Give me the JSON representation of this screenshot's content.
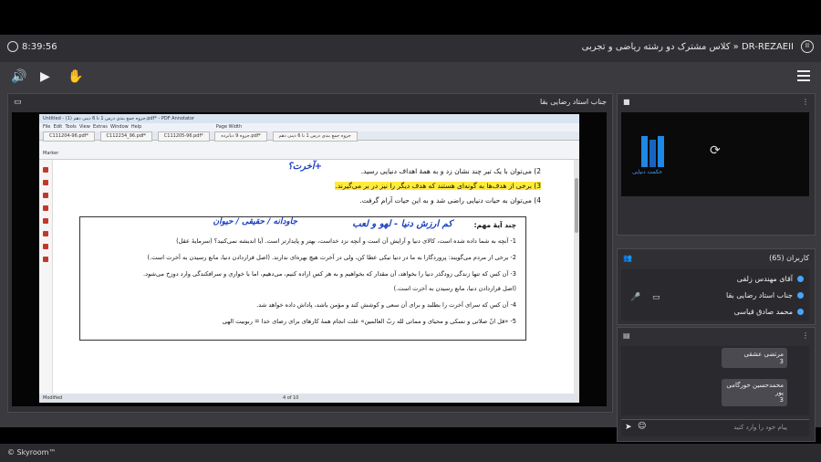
{
  "topbar": {
    "clock": "8:39:56",
    "room_title": "DR-REZAEII « کلاس مشترک دو رشته ریاضی و تجربی"
  },
  "toolbar": {
    "speaker_icon": "speaker-icon",
    "play_icon": "play-icon",
    "hand_icon": "raise-hand-icon"
  },
  "main_panel": {
    "title": "جناب استاد رضایی بقا",
    "pdf": {
      "window_title": "Untitled - جزوه جمع بندی درس 1 تا 6 دینی دهم (1).pdf* - PDF Annotator",
      "menu": [
        "File",
        "Edit",
        "Tools",
        "View",
        "Extras",
        "Window",
        "Help"
      ],
      "tabs": [
        "C111204-96.pdf*",
        "C112234_96.pdf*",
        "C111205-96.pdf*",
        "جزوه 9 دبانرده.pdf*",
        "جزوه جمع بندی درس 1 تا 6 دینی دهم"
      ],
      "zoom": "Page Width",
      "tool_label": "Marker",
      "lines": [
        "2) می‌توان با یک تیر چند نشان زد و به همهٔ اهداف دنیایی رسید.",
        "3) برخی از هدف‌ها به گونه‌ای هستند که هدف دیگر را نیز در بر می‌گیرند.",
        "4) می‌توان به حیات دنیایی راضی شد و به این حیات آرام گرفت."
      ],
      "handwriting": [
        "+آخرت؟",
        "کم ارزش دنیا - لهو و لعب",
        "جاودانه / حقیقی / حیوان"
      ],
      "box_title": "چند آیهٔ مهم:",
      "box_lines": [
        "1- آنچه به شما داده شده است، کالای دنیا و آرایش آن است و آنچه نزد خداست، بهتر و پایدارتر است. آیا اندیشه نمی‌کنید؟ (سرمایهٔ عقل)",
        "2- برخی از مردم می‌گویند: پروردگارا به ما در دنیا نیکی عطا کن، ولی در آخرت هیچ بهره‌ای ندارند. (اصل قراردادن دنیا، مانع رسیدن به آخرت است.)",
        "3- آن کس که تنها زندگی زودگذر دنیا را بخواهد، آن مقدار که بخواهیم و به هر کس اراده کنیم، می‌دهیم، اما با خواری و سرافکندگی وارد دوزخ می‌شود.",
        "(اصل قراردادن دنیا، مانع رسیدن به آخرت است.)",
        "4- آن کس که سرای آخرت را بطلبد و برای آن سعی و کوشش کند و مؤمن باشد، پاداش داده خواهد شد.",
        "5- «قل انّ صلاتی و نسکی و محیای و مماتی لله ربّ العالمین» علت انجام همهٔ کارهای برای رضای خدا = ربوبیت الهی"
      ],
      "status_left": "Modified",
      "page_indicator": "4 of 10"
    }
  },
  "video_panel": {
    "logo_text": "حکمت دنیایی"
  },
  "users_panel": {
    "title": "کاربران (65)",
    "users": [
      "آقای مهندس زلفی",
      "جناب استاد رضایی بقا",
      "محمد صادق قیاسی"
    ]
  },
  "chat_panel": {
    "messages": [
      {
        "name": "مرتضی عشقی",
        "text": "3"
      },
      {
        "name": "محمدحسین خورگامی پور",
        "text": "3"
      }
    ],
    "input_placeholder": "پیام خود را وارد کنید"
  },
  "footer": {
    "brand": "© Skyroom™"
  },
  "colors": {
    "accent_blue": "#4aa3ff",
    "highlight_yellow": "#ffeb3b",
    "panel_bg": "#303034"
  }
}
